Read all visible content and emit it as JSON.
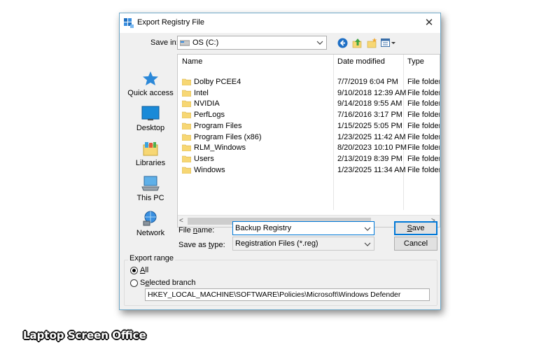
{
  "window": {
    "title": "Export Registry File",
    "close_glyph": "✕"
  },
  "save_in": {
    "label": "Save in:",
    "value": "OS (C:)"
  },
  "toolbar": {
    "back_icon": "back-arrow-icon",
    "up_icon": "up-folder-icon",
    "new_folder_icon": "new-folder-icon",
    "view_icon": "view-menu-icon"
  },
  "places": [
    {
      "label": "Quick access",
      "icon": "star-icon"
    },
    {
      "label": "Desktop",
      "icon": "desktop-icon"
    },
    {
      "label": "Libraries",
      "icon": "libraries-icon"
    },
    {
      "label": "This PC",
      "icon": "computer-icon"
    },
    {
      "label": "Network",
      "icon": "network-icon"
    }
  ],
  "columns": {
    "name": "Name",
    "date": "Date modified",
    "type": "Type",
    "sort_glyph": "^"
  },
  "files": [
    {
      "name": "Dolby PCEE4",
      "date": "7/7/2019 6:04 PM",
      "type": "File folder"
    },
    {
      "name": "Intel",
      "date": "9/10/2018 12:39 AM",
      "type": "File folder"
    },
    {
      "name": "NVIDIA",
      "date": "9/14/2018 9:55 AM",
      "type": "File folder"
    },
    {
      "name": "PerfLogs",
      "date": "7/16/2016 3:17 PM",
      "type": "File folder"
    },
    {
      "name": "Program Files",
      "date": "1/15/2025 5:05 PM",
      "type": "File folder"
    },
    {
      "name": "Program Files (x86)",
      "date": "1/23/2025 11:42 AM",
      "type": "File folder"
    },
    {
      "name": "RLM_Windows",
      "date": "8/20/2023 10:10 PM",
      "type": "File folder"
    },
    {
      "name": "Users",
      "date": "2/13/2019 8:39 PM",
      "type": "File folder"
    },
    {
      "name": "Windows",
      "date": "1/23/2025 11:34 AM",
      "type": "File folder"
    }
  ],
  "scroll": {
    "left_glyph": "<",
    "right_glyph": ">"
  },
  "file_name": {
    "label_pre": "File ",
    "label_u": "n",
    "label_post": "ame:",
    "value": "Backup Registry"
  },
  "save_type": {
    "label_pre": "Save as ",
    "label_u": "t",
    "label_post": "ype:",
    "value": "Registration Files (*.reg)"
  },
  "buttons": {
    "save_u": "S",
    "save_rest": "ave",
    "cancel": "Cancel"
  },
  "export_range": {
    "title": "Export range",
    "all_u": "A",
    "all_rest": "ll",
    "selected_pre": "S",
    "selected_u": "e",
    "selected_rest": "lected branch",
    "branch_value": "HKEY_LOCAL_MACHINE\\SOFTWARE\\Policies\\Microsoft\\Windows Defender"
  },
  "watermark": "Laptop Screen Office",
  "colors": {
    "accent": "#0078d7",
    "folder": "#f7d774",
    "titlebar": "#ffffff",
    "dialog_bg": "#f0f0f0"
  }
}
